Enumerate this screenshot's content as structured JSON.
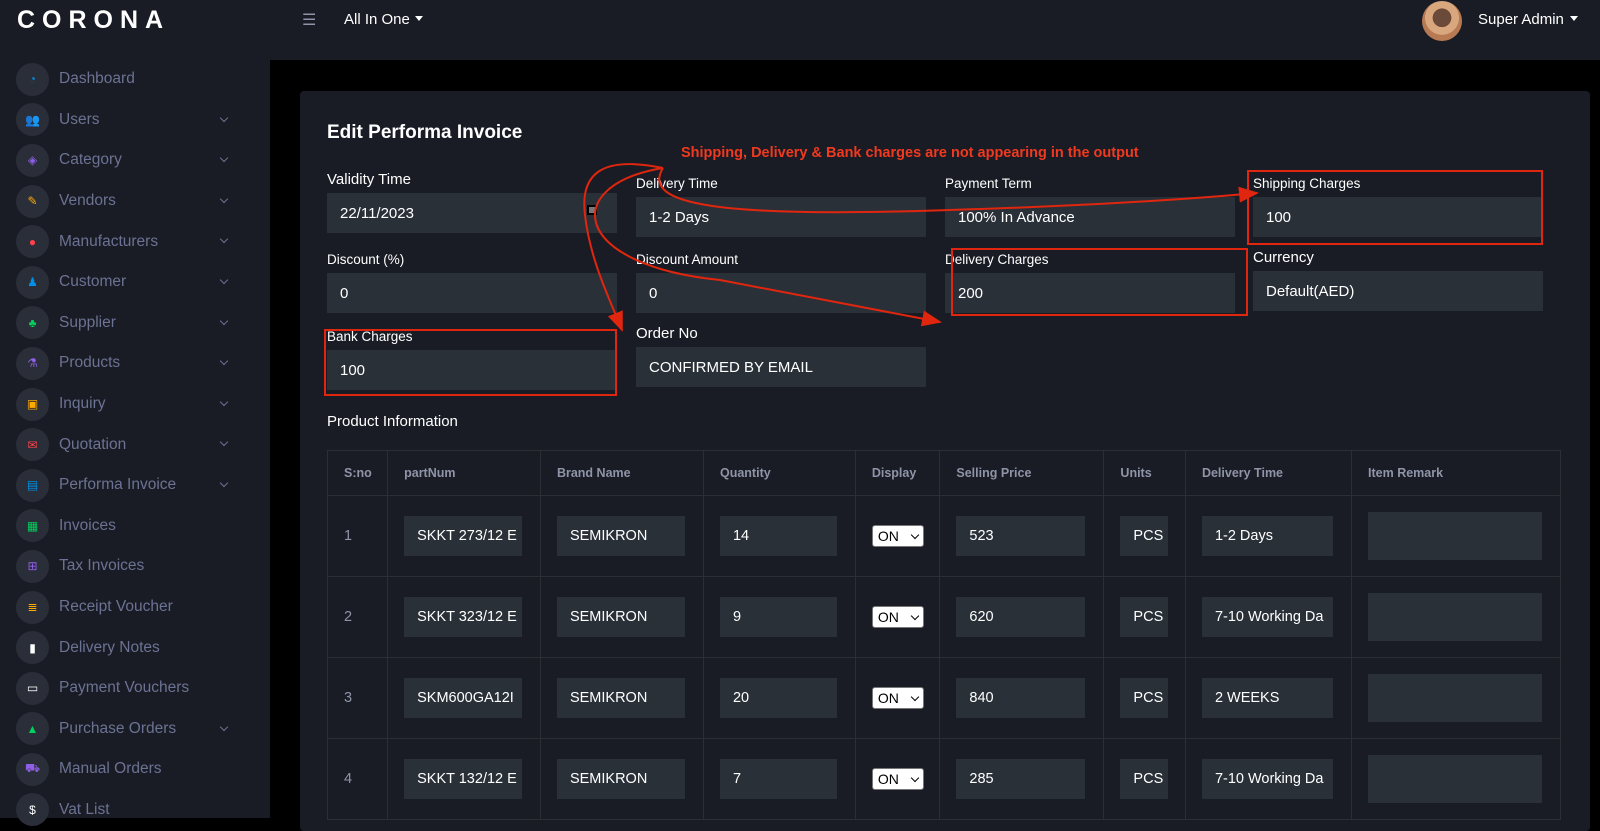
{
  "brand": "CORONA",
  "topbar": {
    "project": "All In One",
    "user": "Super Admin"
  },
  "sidebar": {
    "items": [
      {
        "label": "Dashboard",
        "icon": "speedometer-icon",
        "color": "#0090e7",
        "sym": "◔",
        "chev": false
      },
      {
        "label": "Users",
        "icon": "users-icon",
        "color": "#00d25b",
        "sym": "👥",
        "chev": true
      },
      {
        "label": "Category",
        "icon": "layers-icon",
        "color": "#8f5fe8",
        "sym": "◈",
        "chev": true
      },
      {
        "label": "Vendors",
        "icon": "pencil-icon",
        "color": "#ffab00",
        "sym": "✎",
        "chev": true
      },
      {
        "label": "Manufacturers",
        "icon": "pin-icon",
        "color": "#fc424a",
        "sym": "●",
        "chev": true
      },
      {
        "label": "Customer",
        "icon": "person-icon",
        "color": "#0090e7",
        "sym": "♟",
        "chev": true
      },
      {
        "label": "Supplier",
        "icon": "group-icon",
        "color": "#00d25b",
        "sym": "♣",
        "chev": true
      },
      {
        "label": "Products",
        "icon": "flask-icon",
        "color": "#8f5fe8",
        "sym": "⚗",
        "chev": true
      },
      {
        "label": "Inquiry",
        "icon": "inquiry-icon",
        "color": "#ffab00",
        "sym": "▣",
        "chev": true
      },
      {
        "label": "Quotation",
        "icon": "mail-icon",
        "color": "#fc424a",
        "sym": "✉",
        "chev": true
      },
      {
        "label": "Performa Invoice",
        "icon": "id-card-icon",
        "color": "#0090e7",
        "sym": "▤",
        "chev": true
      },
      {
        "label": "Invoices",
        "icon": "invoice-icon",
        "color": "#00d25b",
        "sym": "▦",
        "chev": false
      },
      {
        "label": "Tax Invoices",
        "icon": "gift-icon",
        "color": "#8f5fe8",
        "sym": "⊞",
        "chev": false
      },
      {
        "label": "Receipt Voucher",
        "icon": "receipt-icon",
        "color": "#ffab00",
        "sym": "≣",
        "chev": false
      },
      {
        "label": "Delivery Notes",
        "icon": "file-icon",
        "color": "#ffffff",
        "sym": "▮",
        "chev": false
      },
      {
        "label": "Payment Vouchers",
        "icon": "cash-icon",
        "color": "#ffffff",
        "sym": "▭",
        "chev": false
      },
      {
        "label": "Purchase Orders",
        "icon": "bag-icon",
        "color": "#00d25b",
        "sym": "▲",
        "chev": true
      },
      {
        "label": "Manual Orders",
        "icon": "cart-icon",
        "color": "#8f5fe8",
        "sym": "⛟",
        "chev": false
      },
      {
        "label": "Vat List",
        "icon": "money-icon",
        "color": "#ffffff",
        "sym": "$",
        "chev": false
      }
    ]
  },
  "page": {
    "title": "Edit Performa Invoice",
    "note": "Shipping, Delivery & Bank charges are not appearing in the output",
    "fields": {
      "validity_time": {
        "label": "Validity Time",
        "value": "22/11/2023"
      },
      "delivery_time": {
        "label": "Delivery Time",
        "value": "1-2 Days"
      },
      "payment_term": {
        "label": "Payment Term",
        "value": "100% In Advance"
      },
      "shipping_charges": {
        "label": "Shipping Charges",
        "value": "100"
      },
      "discount_pct": {
        "label": "Discount (%)",
        "value": "0"
      },
      "discount_amount": {
        "label": "Discount Amount",
        "value": "0"
      },
      "delivery_charges": {
        "label": "Delivery Charges",
        "value": "200"
      },
      "currency": {
        "label": "Currency",
        "value": "Default(AED)"
      },
      "bank_charges": {
        "label": "Bank Charges",
        "value": "100"
      },
      "order_no": {
        "label": "Order No",
        "value": "CONFIRMED BY EMAIL"
      }
    },
    "product_section": "Product Information",
    "table": {
      "columns": [
        "S:no",
        "partNum",
        "Brand Name",
        "Quantity",
        "Display",
        "Selling Price",
        "Units",
        "Delivery Time",
        "Item Remark"
      ],
      "rows": [
        {
          "sno": "1",
          "part": "SKKT 273/12 E",
          "brand": "SEMIKRON",
          "qty": "14",
          "display": "ON",
          "price": "523",
          "units": "PCS",
          "dtime": "1-2 Days",
          "remark": ""
        },
        {
          "sno": "2",
          "part": "SKKT 323/12 E",
          "brand": "SEMIKRON",
          "qty": "9",
          "display": "ON",
          "price": "620",
          "units": "PCS",
          "dtime": "7-10 Working Da",
          "remark": ""
        },
        {
          "sno": "3",
          "part": "SKM600GA12I",
          "brand": "SEMIKRON",
          "qty": "20",
          "display": "ON",
          "price": "840",
          "units": "PCS",
          "dtime": "2 WEEKS",
          "remark": ""
        },
        {
          "sno": "4",
          "part": "SKKT 132/12 E",
          "brand": "SEMIKRON",
          "qty": "7",
          "display": "ON",
          "price": "285",
          "units": "PCS",
          "dtime": "7-10 Working Da",
          "remark": ""
        }
      ]
    }
  },
  "colors": {
    "annotation": "#e0260e",
    "bg": "#000000",
    "panel": "#191c24",
    "input": "#2a3038"
  }
}
